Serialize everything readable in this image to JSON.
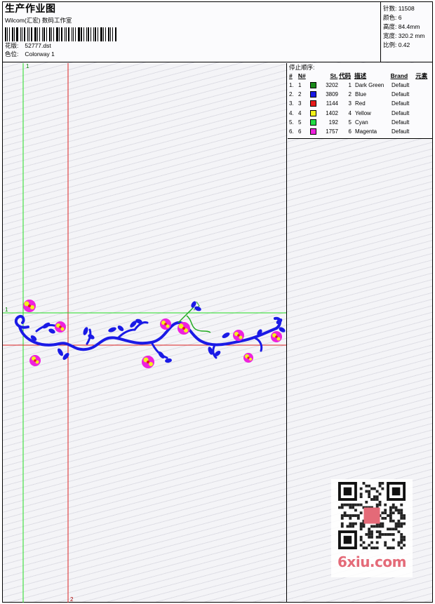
{
  "header": {
    "title": "生产作业图",
    "studio": "Wilcom(汇宏) 数码工作室",
    "pattern_label": "花版:",
    "pattern_value": "52777.dst",
    "colorway_label": "色位:",
    "colorway_value": "Colorway 1"
  },
  "stats": {
    "stitches": "针数: 11508",
    "colors": "颜色: 6",
    "height": "高度: 84.4mm",
    "width": "宽度: 320.2 mm",
    "scale": "比例: 0.42"
  },
  "sequence": {
    "title": "停止顺序:",
    "headers": [
      "#",
      "N#",
      "St.",
      "代码",
      "描述",
      "Brand",
      "元素"
    ],
    "rows": [
      {
        "idx": "1.",
        "no": "1",
        "color": "#1a8a1a",
        "stitches": "3202",
        "code": "1",
        "desc": "Dark Green",
        "brand": "Default"
      },
      {
        "idx": "2.",
        "no": "2",
        "color": "#1a1ae6",
        "stitches": "3809",
        "code": "2",
        "desc": "Blue",
        "brand": "Default"
      },
      {
        "idx": "3.",
        "no": "3",
        "color": "#e61a1a",
        "stitches": "1144",
        "code": "3",
        "desc": "Red",
        "brand": "Default"
      },
      {
        "idx": "4.",
        "no": "4",
        "color": "#f2f21a",
        "stitches": "1402",
        "code": "4",
        "desc": "Yellow",
        "brand": "Default"
      },
      {
        "idx": "5.",
        "no": "5",
        "color": "#22dd44",
        "stitches": "192",
        "code": "5",
        "desc": "Cyan",
        "brand": "Default"
      },
      {
        "idx": "6.",
        "no": "6",
        "color": "#ee22dd",
        "stitches": "1757",
        "code": "6",
        "desc": "Magenta",
        "brand": "Default"
      }
    ]
  },
  "guides": {
    "vertical_green_label": "1",
    "horizontal_green_label": "1",
    "vertical_red_label": "2",
    "green": "#22dd22",
    "red": "#dd2222"
  },
  "watermark": {
    "text": "6xiu.com",
    "color": "#e46a78"
  }
}
